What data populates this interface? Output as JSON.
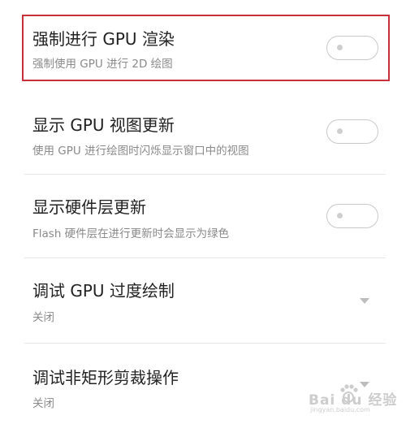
{
  "settings": [
    {
      "title": "强制进行 GPU 渲染",
      "subtitle": "强制使用 GPU 进行 2D 绘图",
      "control": "toggle",
      "checked": false
    },
    {
      "title": "显示 GPU 视图更新",
      "subtitle": "使用 GPU 进行绘图时闪烁显示窗口中的视图",
      "control": "toggle",
      "checked": false
    },
    {
      "title": "显示硬件层更新",
      "subtitle": "Flash 硬件层在进行更新时会显示为绿色",
      "control": "toggle",
      "checked": false
    },
    {
      "title": "调试 GPU 过度绘制",
      "subtitle": "关闭",
      "control": "dropdown"
    },
    {
      "title": "调试非矩形剪裁操作",
      "subtitle": "关闭",
      "control": "dropdown"
    }
  ],
  "watermark": {
    "logo_text": "Bai du 经验",
    "url": "jingyan.baidu.com"
  },
  "colors": {
    "highlight": "#c8313c",
    "title": "#222222",
    "subtitle": "#8a8a8a",
    "toggle_border": "#c9c9c9",
    "divider": "#e6e6e6"
  }
}
